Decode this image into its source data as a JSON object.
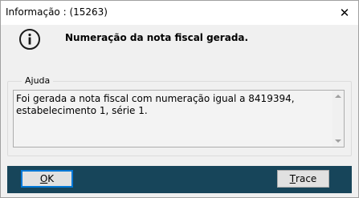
{
  "window": {
    "title": "Informação : (15263)",
    "close_glyph": "✕"
  },
  "header": {
    "icon": "info-icon",
    "message": "Numeração da nota fiscal gerada."
  },
  "help_group": {
    "legend": "Ajuda",
    "text": "Foi gerada a nota fiscal com numeração igual a 8419394, estabelecimento 1, série 1."
  },
  "footer": {
    "background": "#17455a",
    "ok_mnemonic": "O",
    "ok_rest": "K",
    "trace_mnemonic": "T",
    "trace_rest": "race"
  },
  "colors": {
    "focus_border": "#0078d7",
    "icon_color": "#1a1a1a"
  }
}
